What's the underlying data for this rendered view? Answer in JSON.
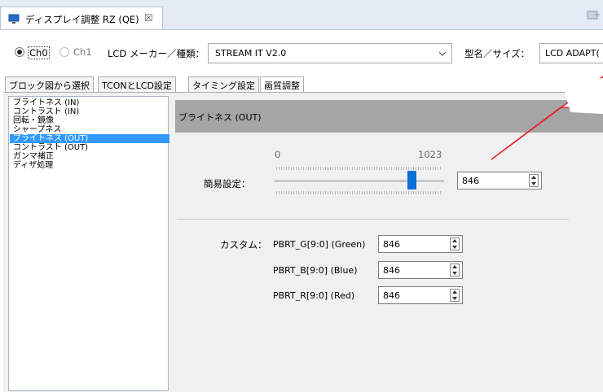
{
  "editor_tab": {
    "title": "ディスプレイ調整 RZ (QE)",
    "close_glyph": "☒"
  },
  "channel": {
    "options": [
      {
        "label": "Ch0",
        "selected": true
      },
      {
        "label": "Ch1",
        "selected": false
      }
    ],
    "lcd_maker_label": "LCD メーカー／種類：",
    "lcd_maker_value": "STREAM IT V2.0",
    "model_label": "型名／サイズ：",
    "model_value": "LCD ADAPT("
  },
  "subtabs": [
    {
      "label": "ブロック図から選択",
      "active": false
    },
    {
      "label": "TCONとLCD設定",
      "active": false
    },
    {
      "label": "タイミング設定",
      "active": false
    },
    {
      "label": "画質調整",
      "active": true
    }
  ],
  "adjust_list": [
    "ブライトネス (IN)",
    "コントラスト (IN)",
    "回転・鏡像",
    "シャープネス",
    "ブライトネス (OUT)",
    "コントラスト (OUT)",
    "ガンマ補正",
    "ディザ処理"
  ],
  "selected_item": "ブライトネス (OUT)",
  "panel": {
    "title": "ブライトネス (OUT)",
    "easy_label": "簡易設定：",
    "slider_min": "0",
    "slider_max": "1023",
    "slider_value": 846,
    "easy_value": "846",
    "custom_label": "カスタム：",
    "custom_fields": [
      {
        "label": "PBRT_G[9:0] (Green)",
        "value": "846"
      },
      {
        "label": "PBRT_B[9:0] (Blue)",
        "value": "846"
      },
      {
        "label": "PBRT_R[9:0] (Red)",
        "value": "846"
      }
    ]
  },
  "colors": {
    "accent": "#0a6fd6",
    "selection": "#3399ff",
    "callout": "#e8222b"
  }
}
